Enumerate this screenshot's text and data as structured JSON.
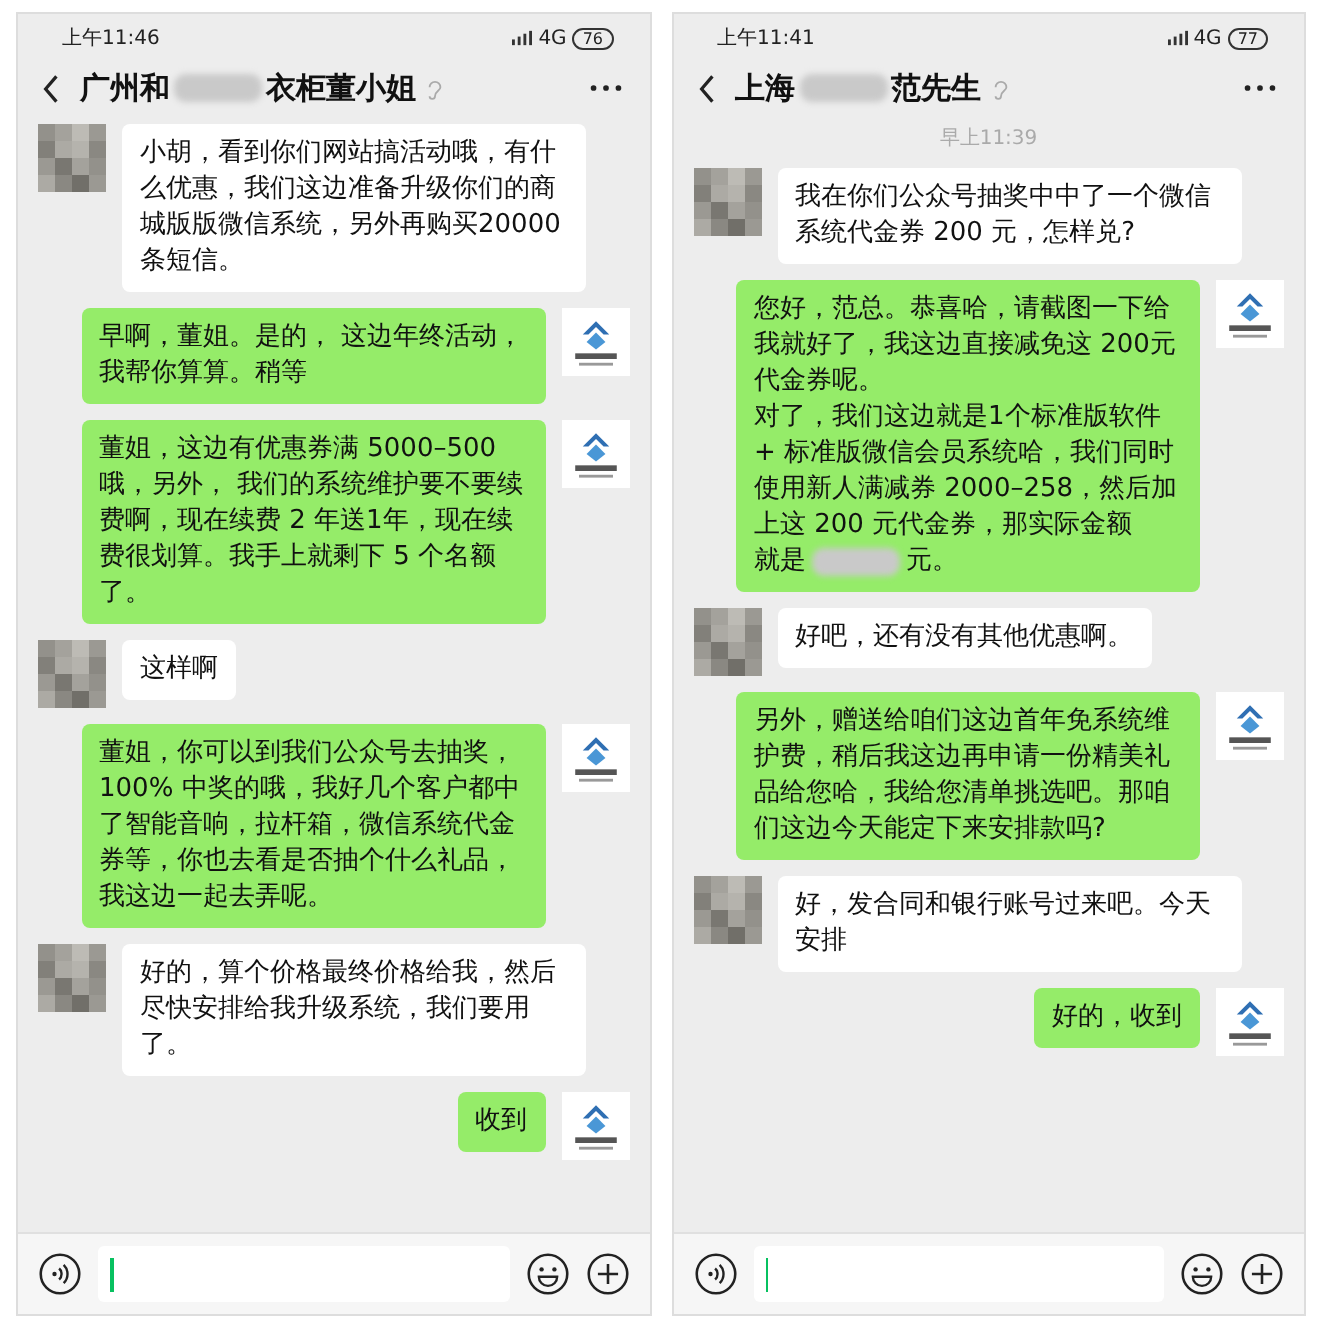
{
  "phones": [
    {
      "status_bar": {
        "time": "上午11:46",
        "network": "4G",
        "battery": "76"
      },
      "header": {
        "title_parts": [
          {
            "kind": "text",
            "text": "广州和"
          },
          {
            "kind": "redacted"
          },
          {
            "kind": "text",
            "text": "衣柜董小姐"
          }
        ]
      },
      "messages": [
        {
          "kind": "received",
          "parts": [
            {
              "kind": "text",
              "text": "小胡，看到你们网站搞活动哦，有什么优惠，我们这边准备升级你们的商城版版微信系统，另外再购买20000 条短信。"
            }
          ]
        },
        {
          "kind": "sent",
          "parts": [
            {
              "kind": "text",
              "text": "早啊，董姐。是的， 这边年终活动，我帮你算算。稍等"
            }
          ]
        },
        {
          "kind": "sent",
          "parts": [
            {
              "kind": "text",
              "text": "董姐，这边有优惠券满 5000–500哦，另外， 我们的系统维护要不要续费啊，现在续费 2 年送1年，现在续费很划算。我手上就剩下 5 个名额了。"
            }
          ]
        },
        {
          "kind": "received",
          "parts": [
            {
              "kind": "text",
              "text": "这样啊"
            }
          ]
        },
        {
          "kind": "sent",
          "parts": [
            {
              "kind": "text",
              "text": "董姐，你可以到我们公众号去抽奖，100% 中奖的哦，我好几个客户都中了智能音响，拉杆箱，微信系统代金券等，你也去看是否抽个什么礼品，我这边一起去弄呢。"
            }
          ]
        },
        {
          "kind": "received",
          "parts": [
            {
              "kind": "text",
              "text": "好的，算个价格最终价格给我，然后尽快安排给我升级系统，我们要用了。"
            }
          ]
        },
        {
          "kind": "sent",
          "parts": [
            {
              "kind": "text",
              "text": "收到"
            }
          ]
        }
      ]
    },
    {
      "status_bar": {
        "time": "上午11:41",
        "network": "4G",
        "battery": "77"
      },
      "header": {
        "title_parts": [
          {
            "kind": "text",
            "text": "上海"
          },
          {
            "kind": "redacted"
          },
          {
            "kind": "text",
            "text": "范先生"
          }
        ]
      },
      "messages": [
        {
          "kind": "timestamp",
          "text": "早上11:39"
        },
        {
          "kind": "received",
          "parts": [
            {
              "kind": "text",
              "text": "我在你们公众号抽奖中中了一个微信系统代金券 200 元，怎样兑?"
            }
          ]
        },
        {
          "kind": "sent",
          "parts": [
            {
              "kind": "text",
              "text": "您好，范总。恭喜哈，请截图一下给我就好了，我这边直接减免这 200元代金券呢。"
            },
            {
              "kind": "text",
              "text": "对了，我们这边就是1个标准版软件+ 标准版微信会员系统哈，我们同时使用新人满减券 2000–258，然后加上这 200 元代金券，那实际金额"
            },
            {
              "kind": "line",
              "segments": [
                {
                  "kind": "text",
                  "text": "就是"
                },
                {
                  "kind": "redacted"
                },
                {
                  "kind": "text",
                  "text": "元。"
                }
              ]
            }
          ]
        },
        {
          "kind": "received",
          "parts": [
            {
              "kind": "text",
              "text": "好吧，还有没有其他优惠啊。"
            }
          ]
        },
        {
          "kind": "sent",
          "parts": [
            {
              "kind": "text",
              "text": "另外，赠送给咱们这边首年免系统维护费，稍后我这边再申请一份精美礼品给您哈，我给您清单挑选吧。那咱们这边今天能定下来安排款吗?"
            }
          ]
        },
        {
          "kind": "received",
          "parts": [
            {
              "kind": "text",
              "text": "好，发合同和银行账号过来吧。今天安排"
            }
          ]
        },
        {
          "kind": "sent",
          "parts": [
            {
              "kind": "text",
              "text": "好的，收到"
            }
          ]
        }
      ]
    }
  ]
}
